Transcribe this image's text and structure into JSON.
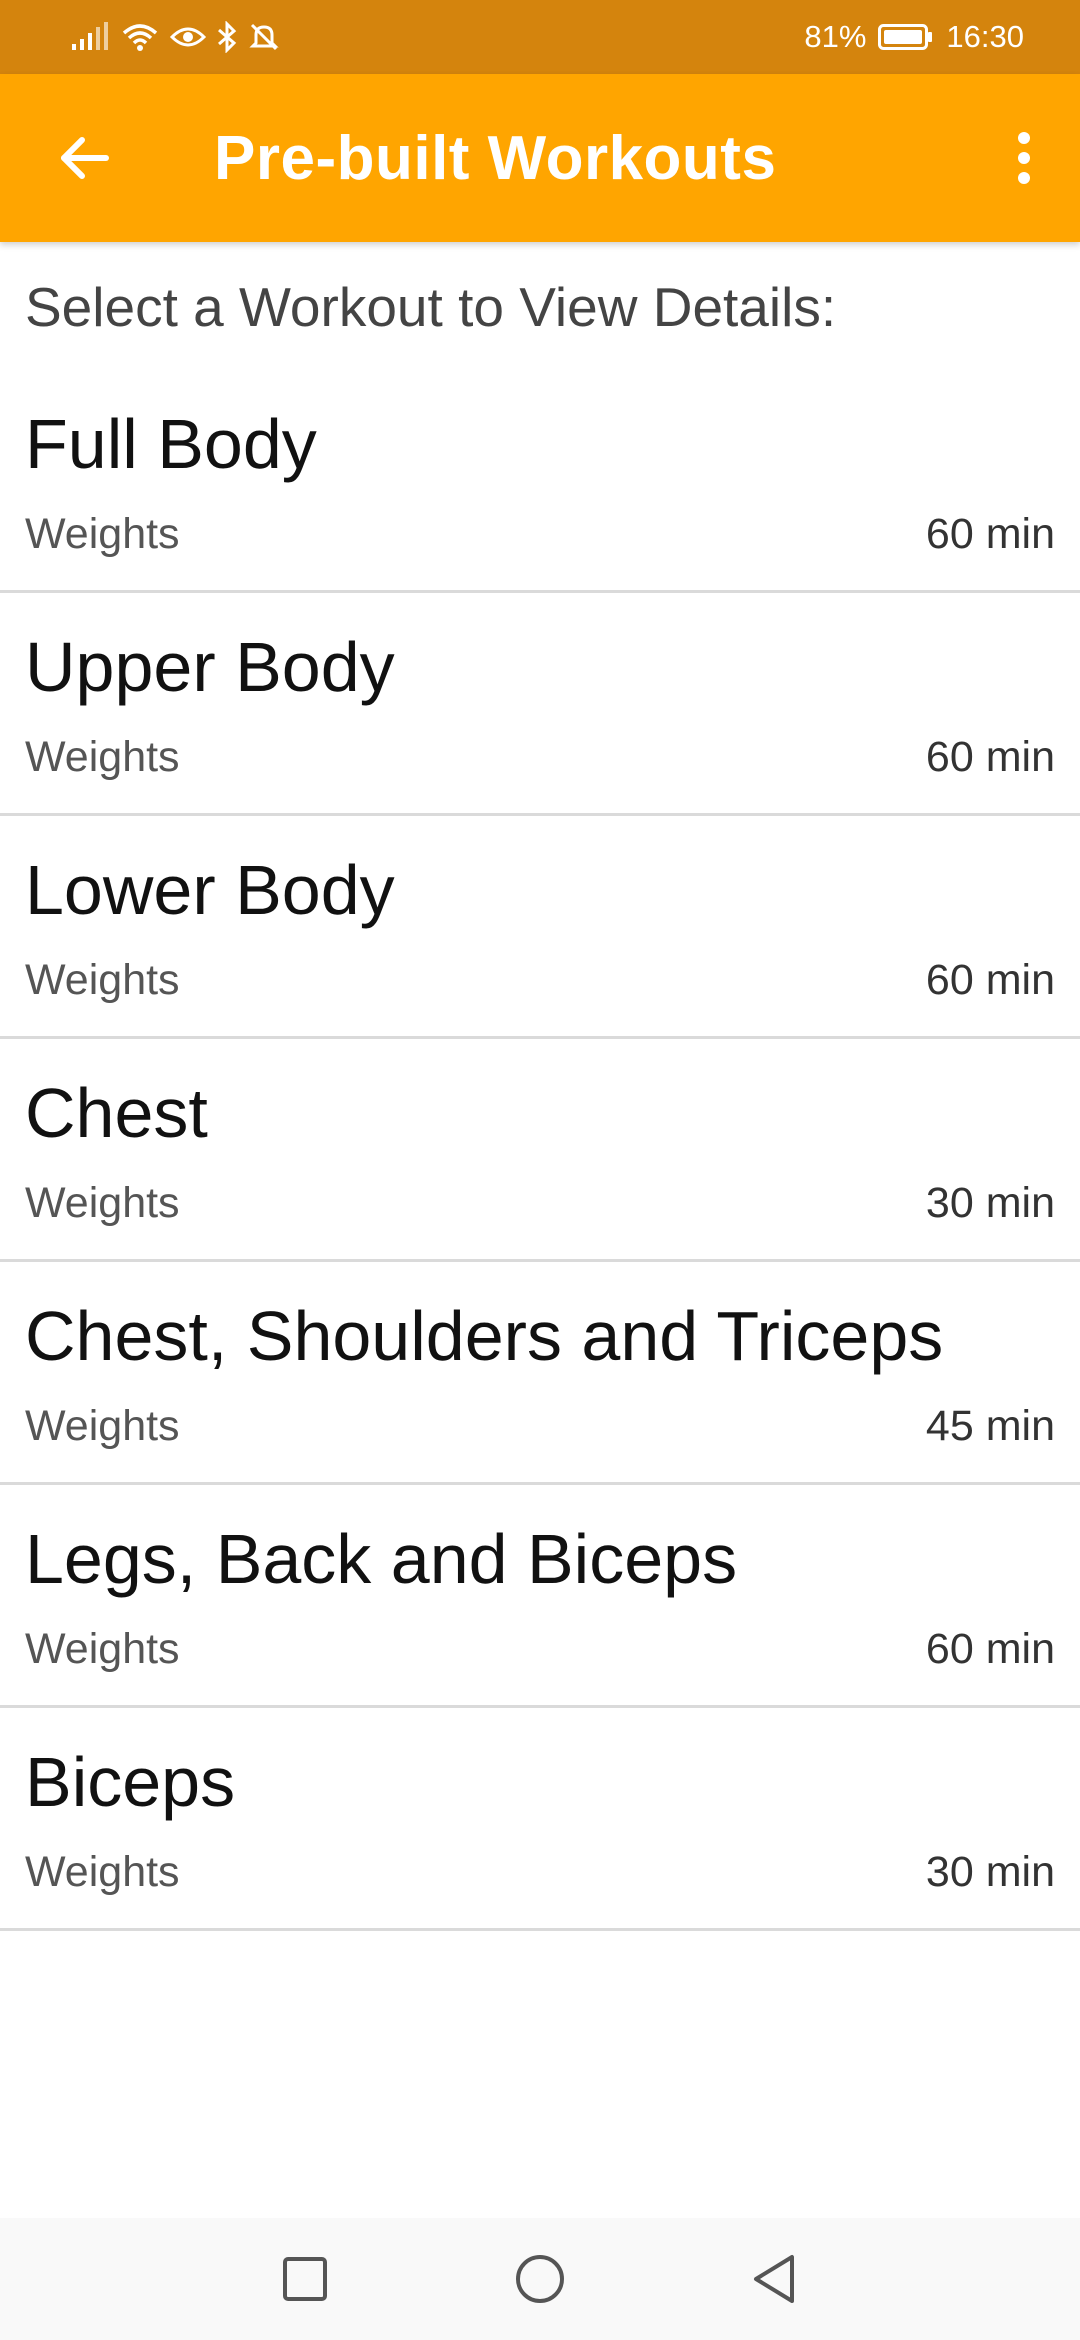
{
  "status_bar": {
    "battery_percent": "81%",
    "time": "16:30",
    "icons": [
      "signal-icon",
      "wifi-icon",
      "eye-icon",
      "bluetooth-icon",
      "alarm-off-icon"
    ]
  },
  "app_bar": {
    "title": "Pre-built Workouts",
    "back_icon": "arrow-back-icon",
    "menu_icon": "more-vert-icon"
  },
  "prompt": "Select a Workout to View Details:",
  "workouts": [
    {
      "name": "Full Body",
      "type": "Weights",
      "duration": "60 min"
    },
    {
      "name": "Upper Body",
      "type": "Weights",
      "duration": "60 min"
    },
    {
      "name": "Lower Body",
      "type": "Weights",
      "duration": "60 min"
    },
    {
      "name": "Chest",
      "type": "Weights",
      "duration": "30 min"
    },
    {
      "name": "Chest, Shoulders and Triceps",
      "type": "Weights",
      "duration": "45 min"
    },
    {
      "name": "Legs, Back and Biceps",
      "type": "Weights",
      "duration": "60 min"
    },
    {
      "name": "Biceps",
      "type": "Weights",
      "duration": "30 min"
    }
  ],
  "colors": {
    "status_bar": "#d4840d",
    "app_bar": "#ffa500",
    "divider": "#dadada"
  }
}
